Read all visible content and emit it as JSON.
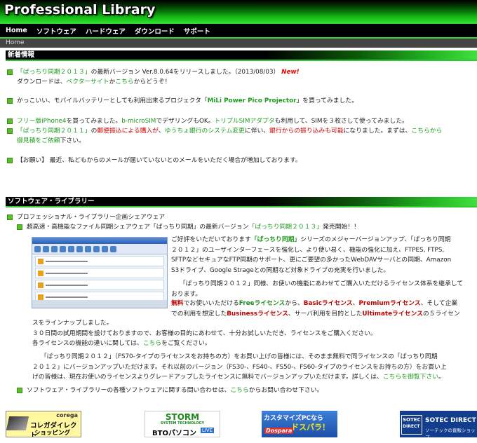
{
  "site": {
    "title": "Professional Library"
  },
  "nav": [
    "Home",
    "ソフトウェア",
    "ハードウェア",
    "ダウンロード",
    "サポート"
  ],
  "breadcrumb": "Home",
  "news_section": {
    "title": "新着情報",
    "items": [
      {
        "a_link": "「ぱっちり同期２０１３」",
        "a_text": "の最新バージョン Ver.8.0.64をリリースしました。（2013/08/03）",
        "badge": "New!",
        "b_pre": "ダウンロードは、",
        "b_link1": "ベクターサイト",
        "b_mid": "か",
        "b_link2": "こちら",
        "b_post": "からどうぞ！"
      },
      {
        "pre": "かっこいい、モバイルバッテリーとしても利用出来るプロジェクタ「",
        "link": "MiLi Power Pico Projector",
        "post": "」を買ってみました。"
      },
      {
        "link1": "フリー版iPhone4",
        "t1": "を買ってみました。",
        "link2": "b-microSIM",
        "t2": "でデザリングもOK。",
        "link3": "トリプルSIMアダプタ",
        "t3": "も利用して、SIMを３枚さして使ってみました。"
      },
      {
        "link1": "「ぱっちり同期２０１１」",
        "t1": "の",
        "red1": "郵便振込による購入が",
        "t2": "、",
        "link2": "ゆうちょ銀行のシステム変更",
        "t3": "に伴い、",
        "red2": "銀行からの振り込みも可能",
        "t4": "になりました。まずは、",
        "link3": "こちらから",
        "link4": "御見積をご依頼",
        "t5": "下さい。"
      },
      {
        "text": "【お願い】 最近、私どもからのメールが届いていないとのメールをいただく場合が増加しております。"
      }
    ]
  },
  "software_section": {
    "title": "ソフトウェア・ライブラリー",
    "heading1": "プロフェッショナル・ライブラリー企画シェアウェア",
    "heading2_pre": "超高速・高機能なファイル同期シェアウェア「ぱっちり同期」の最新バージョン",
    "heading2_link": "「ぱっちり同期２０１３」",
    "heading2_post": "発売開始！！",
    "para1_pre": "ご好評をいただいております",
    "para1_link": "「ぱっちり同期」",
    "para1_l1": "シリーズのメジャーバージョンアップ、「ぱっちり同期",
    "para1_l2": "２０１２」のユーザインターフェースを強化し、より使い易く、機能の強化に加え、FTPES, FTPS,",
    "para1_l3": "SFTPなどセキュアなFTP同期のサポート、更にご要望の多かったWebDAVサーバとの同期、Amazon",
    "para1_l4": "S3ドライブ、Google Strageとの同期など対象ドライブの充実を行いました。",
    "para2_l1": "「ぱっちり同期２０１２」同様、お使いの機能にあわせてご購入いただけるライセンス体系を継承して",
    "para2_l2": "おります。",
    "para3_free": "無料",
    "para3_t1": "でお使いいただける",
    "para3_freel": "Freeライセンス",
    "para3_t2": "から、",
    "para3_basic": "Basicライセンス",
    "para3_t3": "、",
    "para3_prem": "Premiumライセンス",
    "para3_t4": "、そして企業",
    "para3_l2a": "での利用を想定した",
    "para3_bus": "Businessライセンス",
    "para3_l2b": "、サーバ利用を目的とした",
    "para3_ult": "Ultimateライセンス",
    "para3_l2c": "の５ライセン",
    "para3_l3": "スをラインナップしました。",
    "para4": "３０日間の試用期間を設けておりますので、お客様の目的にあわせて、十分お試しいただき、ライセンスをご購入ください。",
    "para5_pre": "各ライセンスの機能の違いに関しては、",
    "para5_link": "こちら",
    "para5_post": "をご覧ください。",
    "para6_l1": "「ぱっちり同期２０１２」（FS70-タイプのライセンスをお持ちの方）をお買い上げの皆様には、そのまま無料で同ライセンスの「ぱっちり同期",
    "para6_l2": "２０１２」にバージョンアップいただけます。それ以前のバージョン（FS30-、FS40-、FS50-、FS60-タイプのライセンスをお持ちの方）をお買い上",
    "para6_l3_pre": "げの皆様は、現在お使いのライセンスよりグレードアップしたライセンスに無料でバージョンアップいただけます。詳しくは、",
    "para6_l3_link": "こちらを御覧下さい",
    "para6_l3_post": "。",
    "contact_pre": "ソフトウェア・ライブラリーの各種ソフトウェアに関する問い合わせは、",
    "contact_link": "こちら",
    "contact_post": "からお問い合わせ下さい。"
  },
  "banners": [
    {
      "top": "corega",
      "main": "コレガダイレクト",
      "sub": "ショッピング"
    },
    {
      "top": "STORM",
      "sub_top": "SYSTEM TECHNOLOGY",
      "main": "BTOパソコン",
      "badge": "LIVE"
    },
    {
      "main": "カスタマイズPCなら",
      "main2": "ドスパラ！",
      "brand": "Dospara"
    },
    {
      "top": "SOTEC",
      "top2": "DIRECT",
      "main": "SOTEC DIRECT",
      "sub": "ソーテックの直販ショップ"
    }
  ],
  "colors": {
    "accent": "#1f9b1f",
    "header_green": "#33e233",
    "alert_red": "#c00000"
  }
}
